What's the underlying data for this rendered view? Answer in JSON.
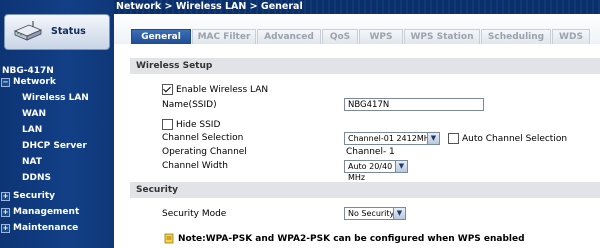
{
  "sidebar": {
    "status_label": "Status",
    "device_name": "NBG-417N",
    "groups": [
      {
        "label": "Network",
        "expanded": true,
        "items": [
          "Wireless LAN",
          "WAN",
          "LAN",
          "DHCP Server",
          "NAT",
          "DDNS"
        ]
      },
      {
        "label": "Security",
        "expanded": false
      },
      {
        "label": "Management",
        "expanded": false
      },
      {
        "label": "Maintenance",
        "expanded": false
      }
    ]
  },
  "breadcrumb": "Network > Wireless LAN > General",
  "tabs": [
    "General",
    "MAC Filter",
    "Advanced",
    "QoS",
    "WPS",
    "WPS Station",
    "Scheduling",
    "WDS"
  ],
  "active_tab": "General",
  "wireless_setup": {
    "heading": "Wireless Setup",
    "enable_label": "Enable Wireless LAN",
    "enable_checked": true,
    "ssid_label": "Name(SSID)",
    "ssid_value": "NBG417N",
    "hide_ssid_label": "Hide SSID",
    "hide_ssid_checked": false,
    "channel_selection_label": "Channel Selection",
    "channel_selection_value": "Channel-01 2412MHz",
    "auto_channel_label": "Auto Channel Selection",
    "auto_channel_checked": false,
    "operating_channel_label": "Operating Channel",
    "operating_channel_value": "Channel- 1",
    "channel_width_label": "Channel Width",
    "channel_width_value": "Auto 20/40 MHz"
  },
  "security": {
    "heading": "Security",
    "mode_label": "Security Mode",
    "mode_value": "No Security",
    "note": "Note:WPA-PSK and WPA2-PSK can be configured when WPS enabled"
  },
  "colors": {
    "sidebar_bg": "#123f86",
    "active_tab": "#1b4a90",
    "section_bg": "#e1e3e6"
  }
}
